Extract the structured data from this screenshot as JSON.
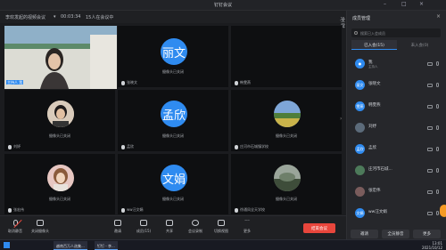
{
  "window": {
    "title": "钉钉会议"
  },
  "meeting_bar": {
    "host_label": "李欢发起的视频会议",
    "timer": "00:03:34",
    "participants_label": "15人在会议中",
    "fullscreen_label": "全屏"
  },
  "tiles": [
    {
      "name": "主持人 我",
      "kind": "video",
      "cam": ""
    },
    {
      "name": "张晓文",
      "kind": "avatar",
      "avatar_text": "丽文",
      "cam": "摄像头已关闭"
    },
    {
      "name": "韩雯燕",
      "kind": "dark",
      "cam": ""
    },
    {
      "name": "刘妤",
      "kind": "photo",
      "cam": "摄像头已关闭"
    },
    {
      "name": "孟欣",
      "kind": "avatar",
      "avatar_text": "孟欣",
      "cam": "摄像头已关闭"
    },
    {
      "name": "庄河市石城镇学校",
      "kind": "photo",
      "cam": "摄像头已关闭"
    },
    {
      "name": "张宏伟",
      "kind": "photo",
      "cam": "摄像头已关闭"
    },
    {
      "name": "ww汪文娟",
      "kind": "avatar",
      "avatar_text": "文娟",
      "cam": "摄像头已关闭"
    },
    {
      "name": "徐通凤全天学校",
      "kind": "photo",
      "cam": "摄像头已关闭"
    }
  ],
  "toolbar": {
    "items": [
      {
        "label": "取消静音",
        "icon": "mic-muted-icon"
      },
      {
        "label": "关闭摄像头",
        "icon": "camera-icon"
      },
      {
        "label": "邀请",
        "icon": "invite-icon"
      },
      {
        "label": "成员(15)",
        "icon": "members-icon"
      },
      {
        "label": "共享",
        "icon": "share-icon"
      },
      {
        "label": "会议录制",
        "icon": "record-icon"
      },
      {
        "label": "切换视图",
        "icon": "view-icon"
      },
      {
        "label": "更多",
        "icon": "more-icon"
      }
    ],
    "end_label": "结束会议"
  },
  "sidebar": {
    "title": "成员管理",
    "search_placeholder": "搜索已入会成员",
    "tabs": {
      "joined": "已入会(15)",
      "not_joined": "未入会(0)"
    },
    "members": [
      {
        "name": "我",
        "sub": "主持人",
        "avatar_color": "#2f8bf0"
      },
      {
        "name": "张晓文",
        "sub": "",
        "avatar_color": "#2f8bf0"
      },
      {
        "name": "韩雯燕",
        "sub": "",
        "avatar_color": "#2f8bf0"
      },
      {
        "name": "刘妤",
        "sub": "",
        "avatar_color": "#5c6b7a"
      },
      {
        "name": "孟欣",
        "sub": "",
        "avatar_color": "#2f8bf0"
      },
      {
        "name": "庄河市石城...",
        "sub": "",
        "avatar_color": "#4d7a5a"
      },
      {
        "name": "张宏伟",
        "sub": "",
        "avatar_color": "#7a5c5c"
      },
      {
        "name": "ww汪文娟",
        "sub": "",
        "avatar_color": "#2f8bf0"
      }
    ],
    "buttons": {
      "invite": "邀请",
      "mute_all": "全员静音",
      "more": "更多"
    }
  },
  "taskbar": {
    "apps": [
      "越南百万人选集...",
      "钉钉 - 李..."
    ],
    "time": "13:01",
    "date": "2021/10/12"
  },
  "colors": {
    "accent": "#2f8bf0",
    "danger": "#e8463c"
  }
}
